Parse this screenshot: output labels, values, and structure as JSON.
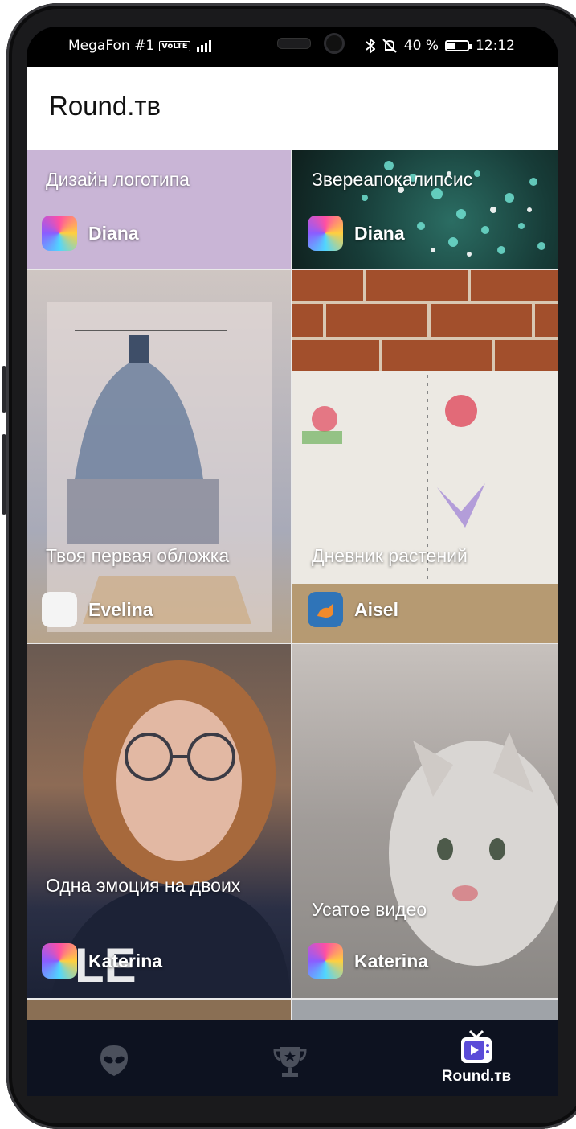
{
  "status_bar": {
    "carrier": "MegaFon #1",
    "network_badge": "VoLTE",
    "battery": "40 %",
    "battery_level": 0.4,
    "time": "12:12"
  },
  "app_bar": {
    "title": "Round.тв"
  },
  "cards": [
    {
      "title": "Дизайн логотипа",
      "author": "Diana",
      "avatar_icon": "colorful-avatar"
    },
    {
      "title": "Звереапокалипсис",
      "author": "Diana",
      "avatar_icon": "colorful-avatar"
    },
    {
      "title": "Твоя первая обложка",
      "author": "Evelina",
      "avatar_icon": "white-avatar"
    },
    {
      "title": "Дневник растений",
      "author": "Aisel",
      "avatar_icon": "fox-avatar"
    },
    {
      "title": "Одна эмоция на двоих",
      "author": "Katerina",
      "avatar_icon": "colorful-avatar"
    },
    {
      "title": "Усатое видео",
      "author": "Katerina",
      "avatar_icon": "colorful-avatar"
    }
  ],
  "bottom_nav": {
    "items": [
      {
        "icon": "alien-icon",
        "label": ""
      },
      {
        "icon": "trophy-icon",
        "label": ""
      },
      {
        "icon": "tv-icon",
        "label": "Round.тв",
        "active": true
      }
    ]
  },
  "colors": {
    "nav_background": "#0d1220",
    "card_lavender": "#c9b5d6",
    "app_bar": "#ffffff"
  }
}
